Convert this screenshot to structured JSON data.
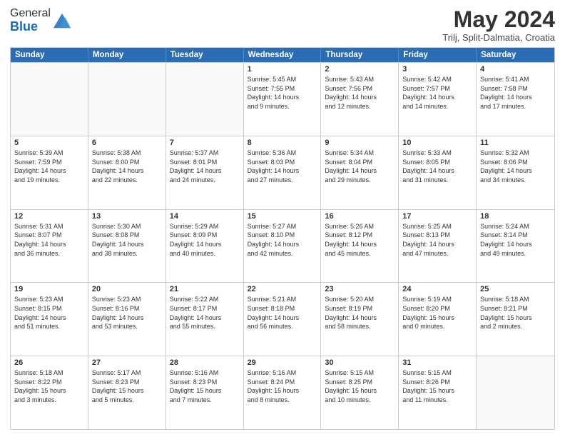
{
  "header": {
    "logo_general": "General",
    "logo_blue": "Blue",
    "title": "May 2024",
    "location": "Trilj, Split-Dalmatia, Croatia"
  },
  "weekdays": [
    "Sunday",
    "Monday",
    "Tuesday",
    "Wednesday",
    "Thursday",
    "Friday",
    "Saturday"
  ],
  "weeks": [
    [
      {
        "day": "",
        "info": ""
      },
      {
        "day": "",
        "info": ""
      },
      {
        "day": "",
        "info": ""
      },
      {
        "day": "1",
        "info": "Sunrise: 5:45 AM\nSunset: 7:55 PM\nDaylight: 14 hours\nand 9 minutes."
      },
      {
        "day": "2",
        "info": "Sunrise: 5:43 AM\nSunset: 7:56 PM\nDaylight: 14 hours\nand 12 minutes."
      },
      {
        "day": "3",
        "info": "Sunrise: 5:42 AM\nSunset: 7:57 PM\nDaylight: 14 hours\nand 14 minutes."
      },
      {
        "day": "4",
        "info": "Sunrise: 5:41 AM\nSunset: 7:58 PM\nDaylight: 14 hours\nand 17 minutes."
      }
    ],
    [
      {
        "day": "5",
        "info": "Sunrise: 5:39 AM\nSunset: 7:59 PM\nDaylight: 14 hours\nand 19 minutes."
      },
      {
        "day": "6",
        "info": "Sunrise: 5:38 AM\nSunset: 8:00 PM\nDaylight: 14 hours\nand 22 minutes."
      },
      {
        "day": "7",
        "info": "Sunrise: 5:37 AM\nSunset: 8:01 PM\nDaylight: 14 hours\nand 24 minutes."
      },
      {
        "day": "8",
        "info": "Sunrise: 5:36 AM\nSunset: 8:03 PM\nDaylight: 14 hours\nand 27 minutes."
      },
      {
        "day": "9",
        "info": "Sunrise: 5:34 AM\nSunset: 8:04 PM\nDaylight: 14 hours\nand 29 minutes."
      },
      {
        "day": "10",
        "info": "Sunrise: 5:33 AM\nSunset: 8:05 PM\nDaylight: 14 hours\nand 31 minutes."
      },
      {
        "day": "11",
        "info": "Sunrise: 5:32 AM\nSunset: 8:06 PM\nDaylight: 14 hours\nand 34 minutes."
      }
    ],
    [
      {
        "day": "12",
        "info": "Sunrise: 5:31 AM\nSunset: 8:07 PM\nDaylight: 14 hours\nand 36 minutes."
      },
      {
        "day": "13",
        "info": "Sunrise: 5:30 AM\nSunset: 8:08 PM\nDaylight: 14 hours\nand 38 minutes."
      },
      {
        "day": "14",
        "info": "Sunrise: 5:29 AM\nSunset: 8:09 PM\nDaylight: 14 hours\nand 40 minutes."
      },
      {
        "day": "15",
        "info": "Sunrise: 5:27 AM\nSunset: 8:10 PM\nDaylight: 14 hours\nand 42 minutes."
      },
      {
        "day": "16",
        "info": "Sunrise: 5:26 AM\nSunset: 8:12 PM\nDaylight: 14 hours\nand 45 minutes."
      },
      {
        "day": "17",
        "info": "Sunrise: 5:25 AM\nSunset: 8:13 PM\nDaylight: 14 hours\nand 47 minutes."
      },
      {
        "day": "18",
        "info": "Sunrise: 5:24 AM\nSunset: 8:14 PM\nDaylight: 14 hours\nand 49 minutes."
      }
    ],
    [
      {
        "day": "19",
        "info": "Sunrise: 5:23 AM\nSunset: 8:15 PM\nDaylight: 14 hours\nand 51 minutes."
      },
      {
        "day": "20",
        "info": "Sunrise: 5:23 AM\nSunset: 8:16 PM\nDaylight: 14 hours\nand 53 minutes."
      },
      {
        "day": "21",
        "info": "Sunrise: 5:22 AM\nSunset: 8:17 PM\nDaylight: 14 hours\nand 55 minutes."
      },
      {
        "day": "22",
        "info": "Sunrise: 5:21 AM\nSunset: 8:18 PM\nDaylight: 14 hours\nand 56 minutes."
      },
      {
        "day": "23",
        "info": "Sunrise: 5:20 AM\nSunset: 8:19 PM\nDaylight: 14 hours\nand 58 minutes."
      },
      {
        "day": "24",
        "info": "Sunrise: 5:19 AM\nSunset: 8:20 PM\nDaylight: 15 hours\nand 0 minutes."
      },
      {
        "day": "25",
        "info": "Sunrise: 5:18 AM\nSunset: 8:21 PM\nDaylight: 15 hours\nand 2 minutes."
      }
    ],
    [
      {
        "day": "26",
        "info": "Sunrise: 5:18 AM\nSunset: 8:22 PM\nDaylight: 15 hours\nand 3 minutes."
      },
      {
        "day": "27",
        "info": "Sunrise: 5:17 AM\nSunset: 8:23 PM\nDaylight: 15 hours\nand 5 minutes."
      },
      {
        "day": "28",
        "info": "Sunrise: 5:16 AM\nSunset: 8:23 PM\nDaylight: 15 hours\nand 7 minutes."
      },
      {
        "day": "29",
        "info": "Sunrise: 5:16 AM\nSunset: 8:24 PM\nDaylight: 15 hours\nand 8 minutes."
      },
      {
        "day": "30",
        "info": "Sunrise: 5:15 AM\nSunset: 8:25 PM\nDaylight: 15 hours\nand 10 minutes."
      },
      {
        "day": "31",
        "info": "Sunrise: 5:15 AM\nSunset: 8:26 PM\nDaylight: 15 hours\nand 11 minutes."
      },
      {
        "day": "",
        "info": ""
      }
    ]
  ]
}
